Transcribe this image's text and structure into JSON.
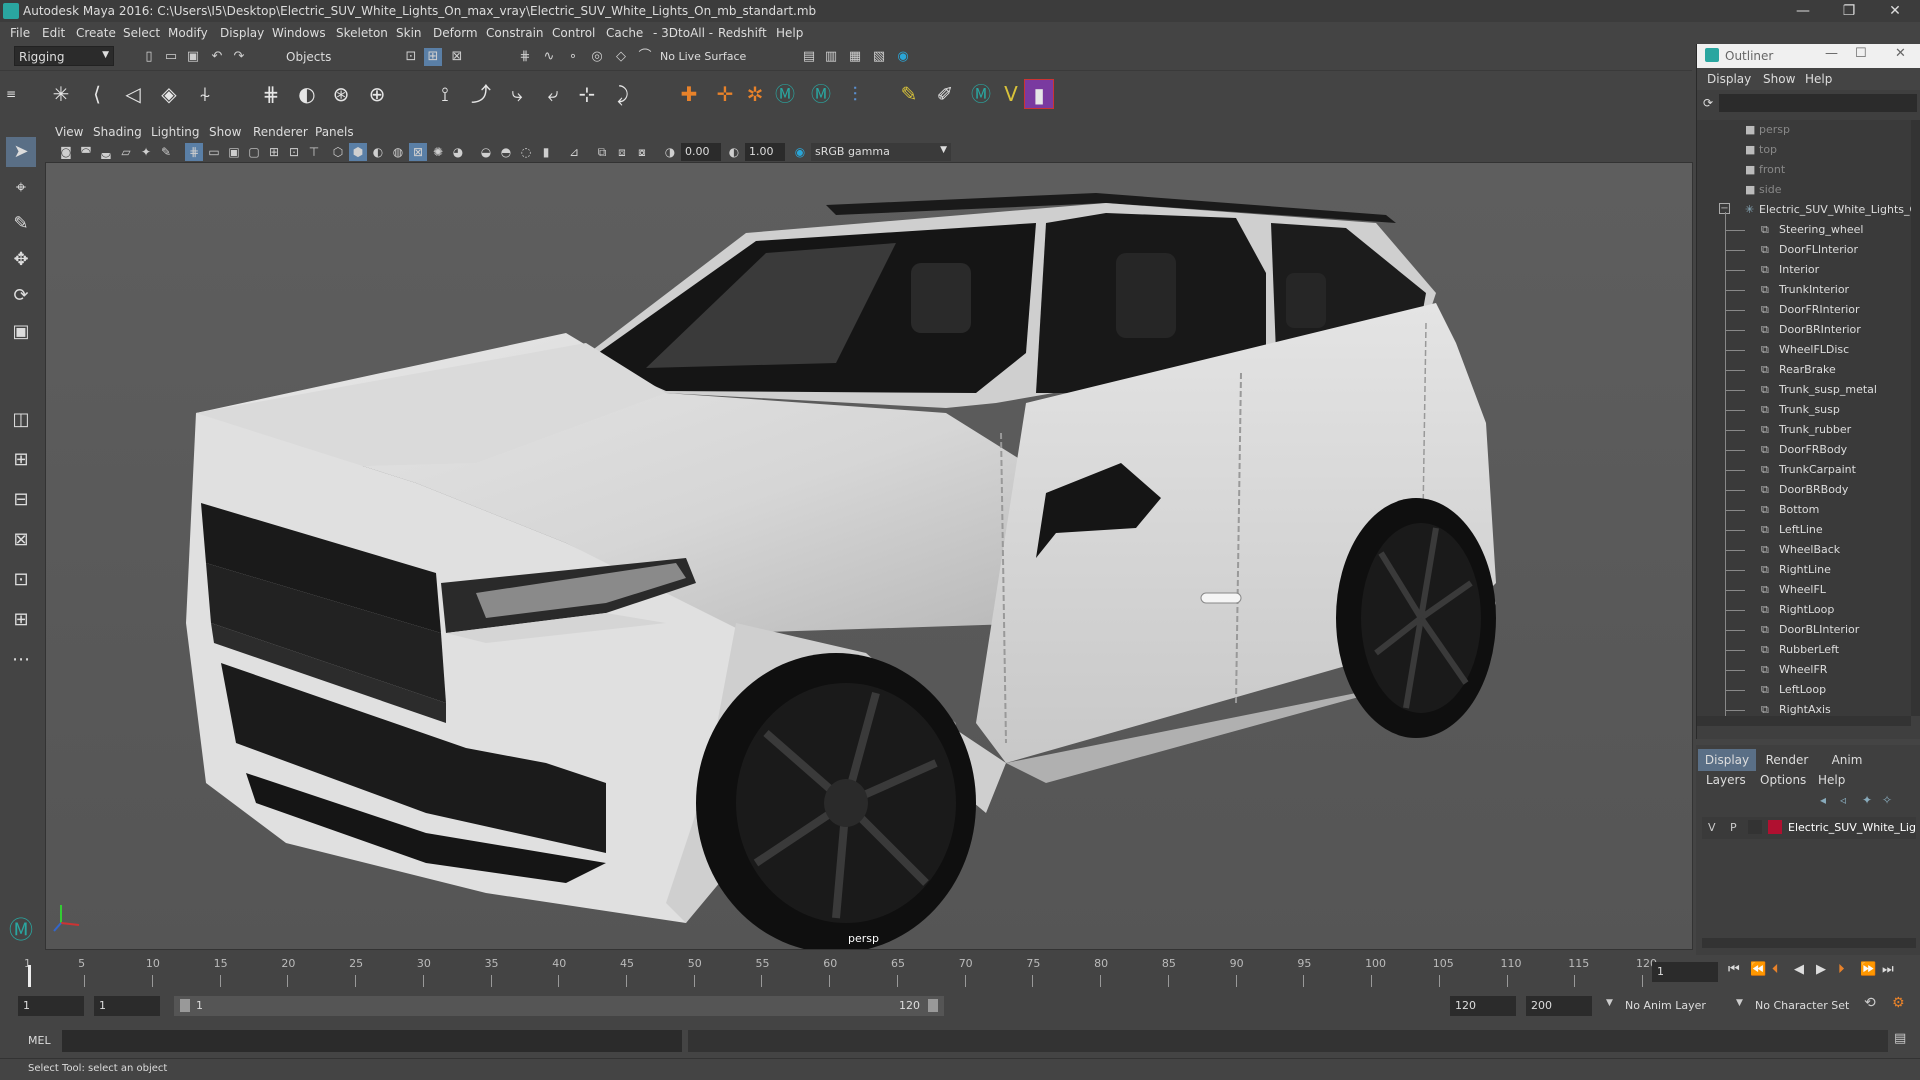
{
  "window": {
    "title": "Autodesk Maya 2016: C:\\Users\\I5\\Desktop\\Electric_SUV_White_Lights_On_max_vray\\Electric_SUV_White_Lights_On_mb_standart.mb",
    "minimize": "—",
    "restore": "❐",
    "close": "✕"
  },
  "menus": [
    "File",
    "Edit",
    "Create",
    "Select",
    "Modify",
    "Display",
    "Windows",
    "Skeleton",
    "Skin",
    "Deform",
    "Constrain",
    "Control",
    "Cache",
    "- 3DtoAll -",
    "Redshift",
    "Help"
  ],
  "status": {
    "mode": "Rigging",
    "objects": "Objects",
    "live_surface": "No Live Surface"
  },
  "viewport": {
    "menus": [
      "View",
      "Shading",
      "Lighting",
      "Show",
      "Renderer",
      "Panels"
    ],
    "field1": "0.00",
    "field2": "1.00",
    "color_space": "sRGB gamma",
    "camera_label": "persp"
  },
  "outliner": {
    "title": "Outliner",
    "menus": [
      "Display",
      "Show",
      "Help"
    ],
    "cameras": [
      "persp",
      "top",
      "front",
      "side"
    ],
    "root": "Electric_SUV_White_Lights_O",
    "items": [
      "Steering_wheel",
      "DoorFLInterior",
      "Interior",
      "TrunkInterior",
      "DoorFRInterior",
      "DoorBRInterior",
      "WheelFLDisc",
      "RearBrake",
      "Trunk_susp_metal",
      "Trunk_susp",
      "Trunk_rubber",
      "DoorFRBody",
      "TrunkCarpaint",
      "DoorBRBody",
      "Bottom",
      "LeftLine",
      "WheelBack",
      "RightLine",
      "WheelFL",
      "RightLoop",
      "DoorBLInterior",
      "RubberLeft",
      "WheelFR",
      "LeftLoop",
      "RightAxis"
    ]
  },
  "layers": {
    "tabs": [
      "Display",
      "Render",
      "Anim"
    ],
    "menus": [
      "Layers",
      "Options",
      "Help"
    ],
    "row": {
      "v": "V",
      "p": "P",
      "name": "Electric_SUV_White_Lig",
      "color": "#b01030"
    }
  },
  "timeline": {
    "ticks": [
      "1",
      "5",
      "10",
      "15",
      "20",
      "25",
      "30",
      "35",
      "40",
      "45",
      "50",
      "55",
      "60",
      "65",
      "70",
      "75",
      "80",
      "85",
      "90",
      "95",
      "100",
      "105",
      "110",
      "115",
      "120"
    ],
    "current": "1"
  },
  "range": {
    "start": "1",
    "start2": "1",
    "slider_start": "1",
    "slider_end": "120",
    "end": "120",
    "end2": "200",
    "anim_layer": "No Anim Layer",
    "char_set": "No Character Set"
  },
  "mel": {
    "label": "MEL"
  },
  "help": {
    "text": "Select Tool: select an object"
  }
}
